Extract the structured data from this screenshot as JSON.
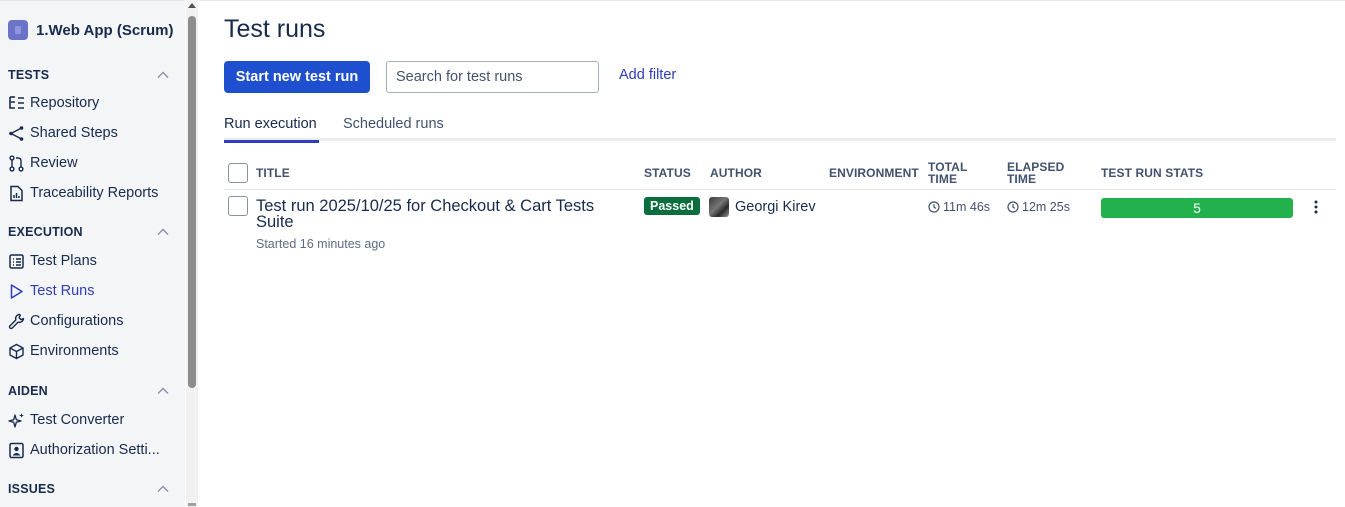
{
  "sidebar": {
    "project_name": "1.Web App (Scrum)",
    "sections": [
      {
        "title": "TESTS",
        "items": [
          {
            "label": "Repository",
            "icon": "tree-list-icon"
          },
          {
            "label": "Shared Steps",
            "icon": "share-nodes-icon"
          },
          {
            "label": "Review",
            "icon": "pull-request-icon"
          },
          {
            "label": "Traceability Reports",
            "icon": "report-document-icon"
          }
        ]
      },
      {
        "title": "EXECUTION",
        "items": [
          {
            "label": "Test Plans",
            "icon": "list-table-icon"
          },
          {
            "label": "Test Runs",
            "icon": "play-outline-icon",
            "active": true
          },
          {
            "label": "Configurations",
            "icon": "wrench-icon"
          },
          {
            "label": "Environments",
            "icon": "cube-icon"
          }
        ]
      },
      {
        "title": "AIDEN",
        "items": [
          {
            "label": "Test Converter",
            "icon": "sparkles-icon"
          },
          {
            "label": "Authorization Setti...",
            "icon": "user-badge-icon"
          }
        ]
      },
      {
        "title": "ISSUES",
        "items": []
      }
    ]
  },
  "main": {
    "title": "Test runs",
    "start_button": "Start new test run",
    "search_placeholder": "Search for test runs",
    "add_filter": "Add filter",
    "tabs": [
      {
        "label": "Run execution",
        "active": true
      },
      {
        "label": "Scheduled runs",
        "active": false
      }
    ],
    "columns": {
      "title": "TITLE",
      "status": "STATUS",
      "author": "AUTHOR",
      "environment": "ENVIRONMENT",
      "total_time_1": "TOTAL",
      "total_time_2": "TIME",
      "elapsed_time_1": "ELAPSED",
      "elapsed_time_2": "TIME",
      "stats": "TEST RUN STATS"
    },
    "rows": [
      {
        "title": "Test run 2025/10/25 for Checkout & Cart Tests Suite",
        "started": "Started 16 minutes ago",
        "status": "Passed",
        "author": "Georgi Kirev",
        "environment": "",
        "total_time": "11m 46s",
        "elapsed_time": "12m 25s",
        "stats_passed": "5"
      }
    ]
  },
  "colors": {
    "primary": "#1d4fce",
    "link": "#2f3db8",
    "passed_badge": "#0b6e3d",
    "stats_green": "#22b14c",
    "sidebar_bg": "#f4f5f7"
  }
}
